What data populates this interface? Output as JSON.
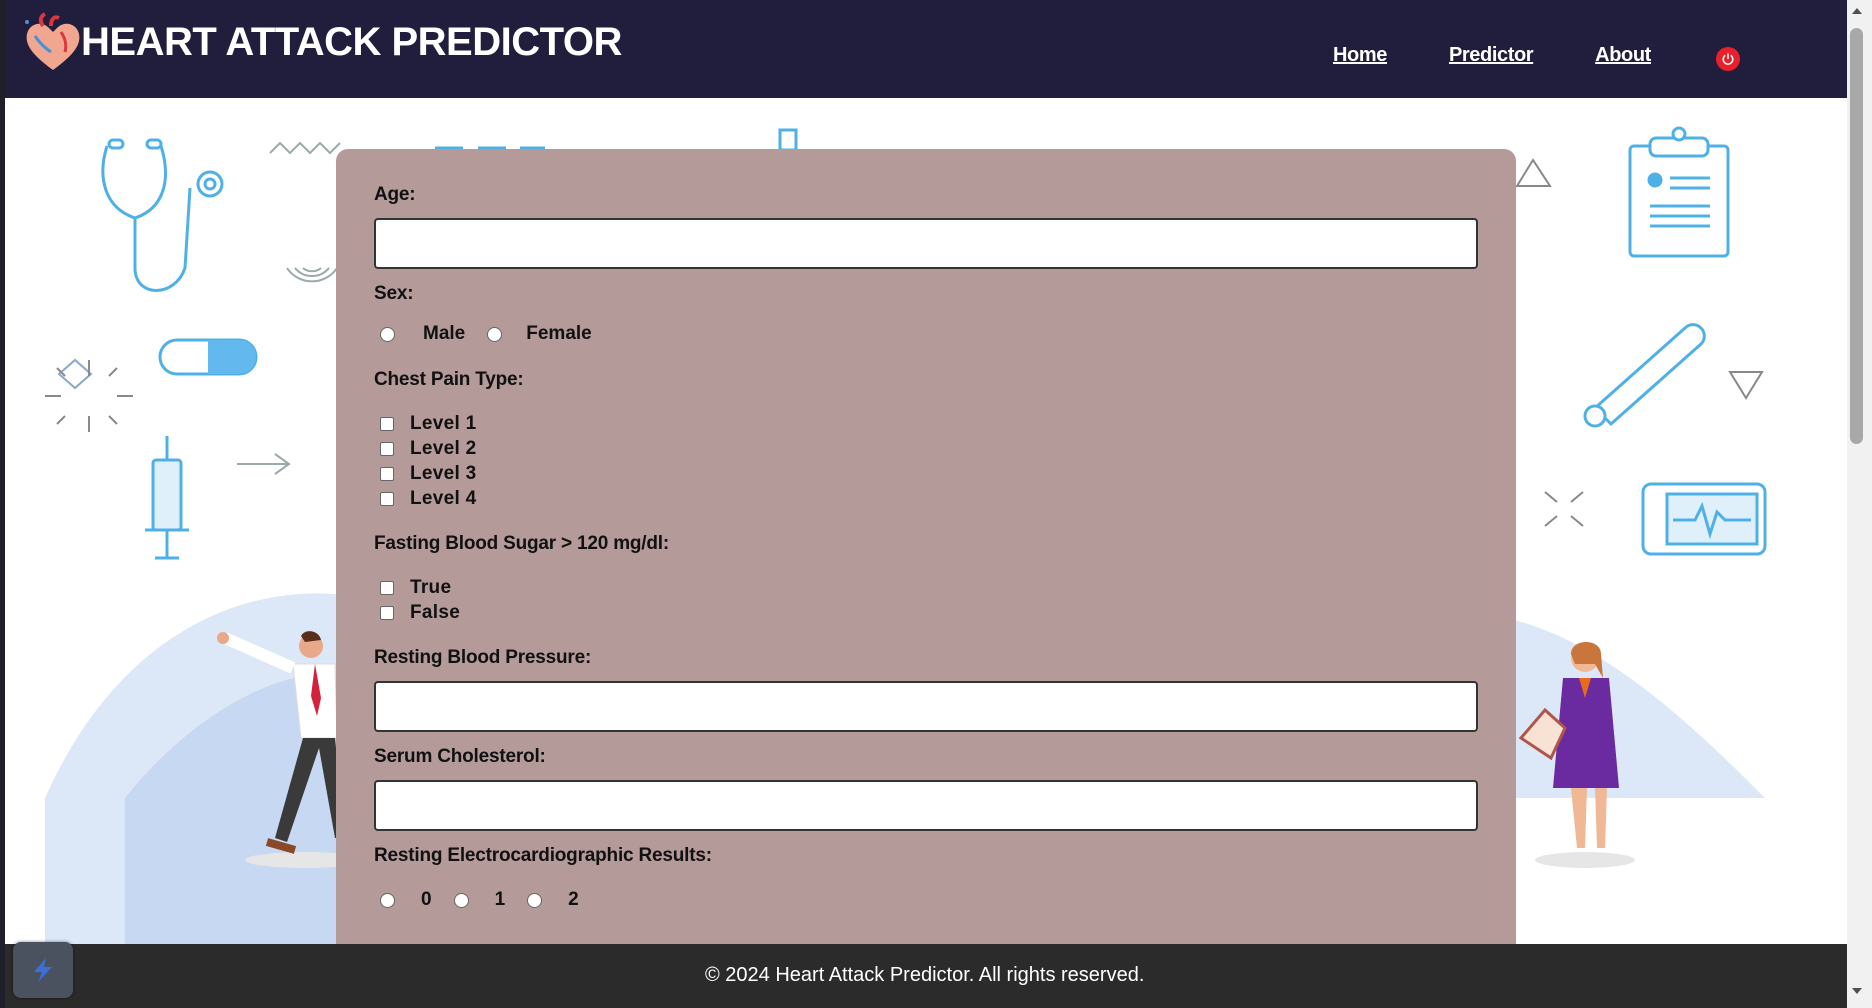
{
  "brand": {
    "title": "HEART ATTACK PREDICTOR",
    "logo_icon": "heart-logo-icon"
  },
  "nav": {
    "items": [
      {
        "label": "Home"
      },
      {
        "label": "Predictor"
      },
      {
        "label": "About"
      }
    ],
    "power_icon": "power-icon",
    "accent": "#e8202a",
    "bar_color": "#211d3d"
  },
  "form": {
    "card_color": "#b59a9a",
    "age_label": "Age:",
    "age_value": "",
    "sex_label": "Sex:",
    "sex_options": [
      "Male",
      "Female"
    ],
    "chest_pain_label": "Chest Pain Type:",
    "chest_pain_options": [
      "Level 1",
      "Level 2",
      "Level 3",
      "Level 4"
    ],
    "fbs_label": "Fasting Blood Sugar > 120 mg/dl:",
    "fbs_options": [
      "True",
      "False"
    ],
    "rbp_label": "Resting Blood Pressure:",
    "rbp_value": "",
    "chol_label": "Serum Cholesterol:",
    "chol_value": "",
    "ecg_label": "Resting Electrocardiographic Results:",
    "ecg_options": [
      "0",
      "1",
      "2"
    ]
  },
  "footer": {
    "text": "© 2024 Heart Attack Predictor. All rights reserved."
  }
}
